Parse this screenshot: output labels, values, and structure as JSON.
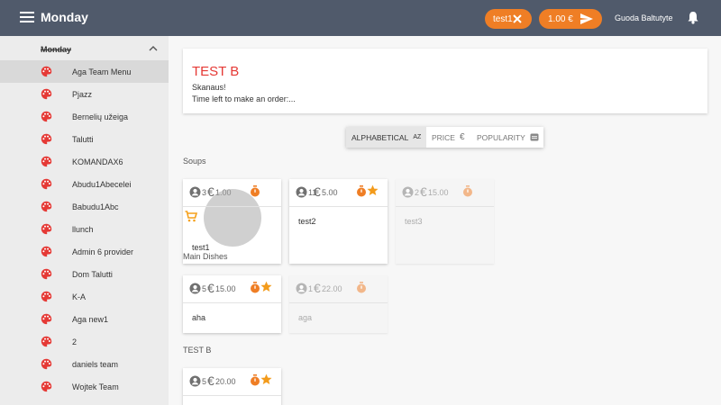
{
  "header": {
    "title": "Monday",
    "order_pill_label": "test1",
    "price_pill_label": "1.00 €",
    "user_name": "Guoda Baltutyte"
  },
  "sidebar": {
    "header": "Monday",
    "items": [
      {
        "label": "Aga Team Menu",
        "active": true
      },
      {
        "label": "Pjazz"
      },
      {
        "label": "Bernelių užeiga"
      },
      {
        "label": "Talutti"
      },
      {
        "label": "KOMANDAX6"
      },
      {
        "label": "Abudu1Abecelei"
      },
      {
        "label": "Babudu1Abc"
      },
      {
        "label": "llunch"
      },
      {
        "label": "Admin 6 provider"
      },
      {
        "label": "Dom Talutti"
      },
      {
        "label": "K-A"
      },
      {
        "label": "Aga new1"
      },
      {
        "label": "2"
      },
      {
        "label": "daniels team"
      },
      {
        "label": "Wojtek Team"
      }
    ]
  },
  "info": {
    "title": "TEST B",
    "line1": "Skanaus!",
    "line2": "Time left to make an order:..."
  },
  "sort": {
    "alphabetical": "ALPHABETICAL",
    "alphabetical_icon": "AZ",
    "price": "PRICE",
    "price_icon": "€",
    "popularity": "POPULARITY"
  },
  "sections": {
    "soups": "Soups",
    "test_b": "TEST B"
  },
  "dishes": {
    "d1": {
      "count": "3",
      "currency": "€",
      "price": "1.00",
      "name": "test1",
      "category": "Main Dishes"
    },
    "d2": {
      "count": "11",
      "currency": "€",
      "price": "5.00",
      "name": "test2"
    },
    "d3": {
      "count": "2",
      "currency": "€",
      "price": "15.00",
      "name": "test3"
    },
    "d4": {
      "count": "5",
      "currency": "€",
      "price": "15.00",
      "name": "aha"
    },
    "d5": {
      "count": "1",
      "currency": "€",
      "price": "22.00",
      "name": "aga"
    },
    "d6": {
      "count": "5",
      "currency": "€",
      "price": "20.00"
    }
  },
  "colors": {
    "topbar": "#505a6b",
    "accent": "#ef7e25",
    "title_red": "#e53935",
    "sidebar_bg": "#ececec"
  }
}
